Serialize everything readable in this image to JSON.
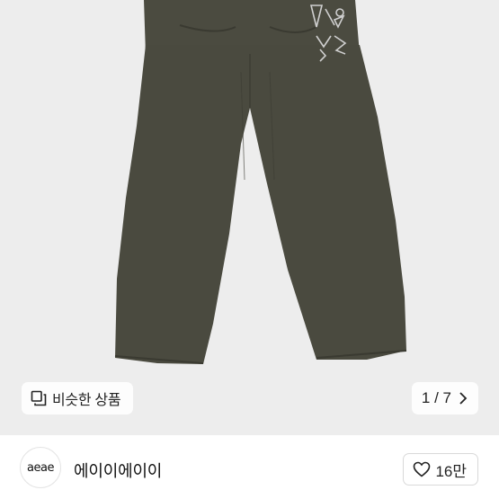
{
  "image": {
    "background": "#ededed",
    "garment_color": "#4a4a3f",
    "similar_label": "비슷한 상품",
    "pager": "1 / 7"
  },
  "shop": {
    "avatar_text": "aeae",
    "name": "에이이에이이",
    "likes": "16만"
  }
}
